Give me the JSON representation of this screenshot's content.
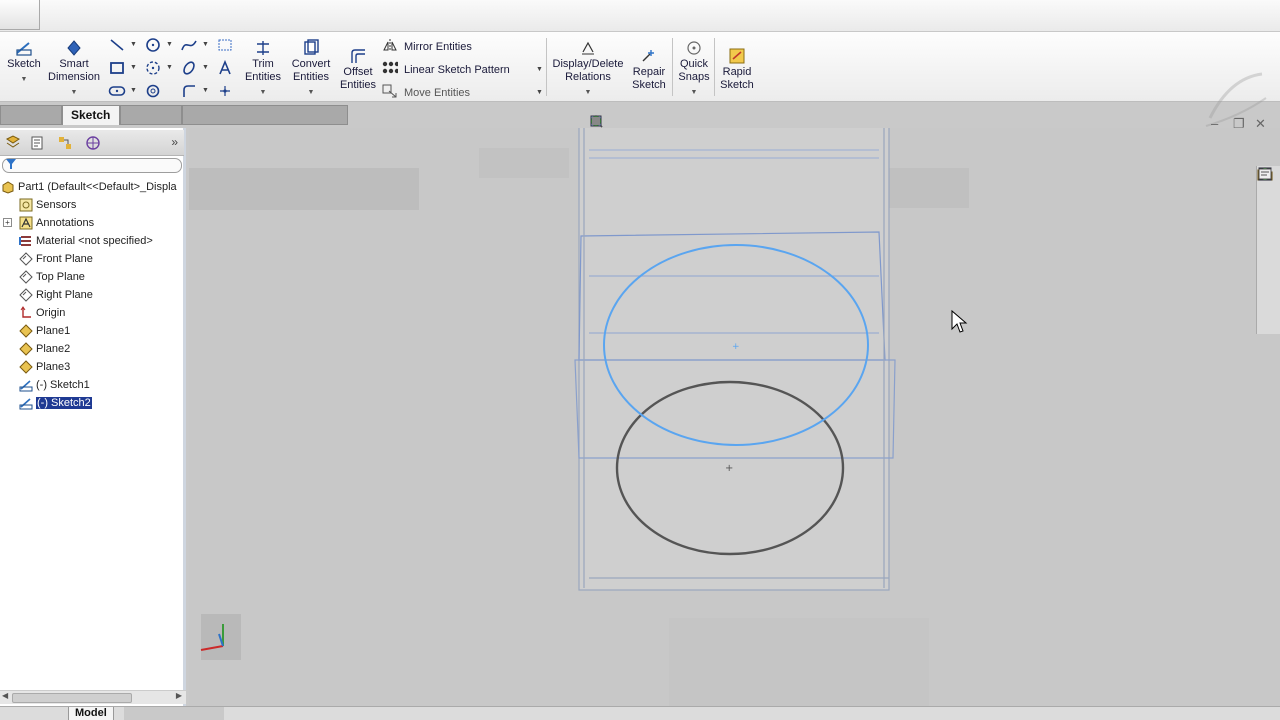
{
  "ribbon": {
    "sketch_label": "Sketch",
    "smart_dimension": [
      "Smart",
      "Dimension"
    ],
    "trim_entities": [
      "Trim",
      "Entities"
    ],
    "convert_entities": [
      "Convert",
      "Entities"
    ],
    "offset_entities": [
      "Offset",
      "Entities"
    ],
    "mirror_entities": "Mirror Entities",
    "linear_sketch_pattern": "Linear Sketch Pattern",
    "move_entities": "Move Entities",
    "display_delete_relations": [
      "Display/Delete",
      "Relations"
    ],
    "repair_sketch": [
      "Repair",
      "Sketch"
    ],
    "quick_snaps": [
      "Quick",
      "Snaps"
    ],
    "rapid_sketch": [
      "Rapid",
      "Sketch"
    ]
  },
  "tabs": {
    "active": "Sketch"
  },
  "tree": {
    "root": "Part1  (Default<<Default>_Displa",
    "items": [
      {
        "label": "Sensors",
        "icon": "sensor-icon"
      },
      {
        "label": "Annotations",
        "icon": "annotations-icon"
      },
      {
        "label": "Material <not specified>",
        "icon": "material-icon"
      },
      {
        "label": "Front Plane",
        "icon": "plane-icon"
      },
      {
        "label": "Top Plane",
        "icon": "plane-icon"
      },
      {
        "label": "Right Plane",
        "icon": "plane-icon"
      },
      {
        "label": "Origin",
        "icon": "origin-icon"
      },
      {
        "label": "Plane1",
        "icon": "plane-icon"
      },
      {
        "label": "Plane2",
        "icon": "plane-icon"
      },
      {
        "label": "Plane3",
        "icon": "plane-icon"
      },
      {
        "label": "(-) Sketch1",
        "icon": "sketch-icon"
      },
      {
        "label": "(-) Sketch2",
        "icon": "sketch-icon",
        "selected": true
      }
    ]
  },
  "bottom_tabs": {
    "model": "Model"
  },
  "colors": {
    "accent_blue": "#2e73c8",
    "selected_bg": "#1f3a93",
    "sketch_active": "#5aa5f0",
    "sketch_inactive": "#555555"
  }
}
